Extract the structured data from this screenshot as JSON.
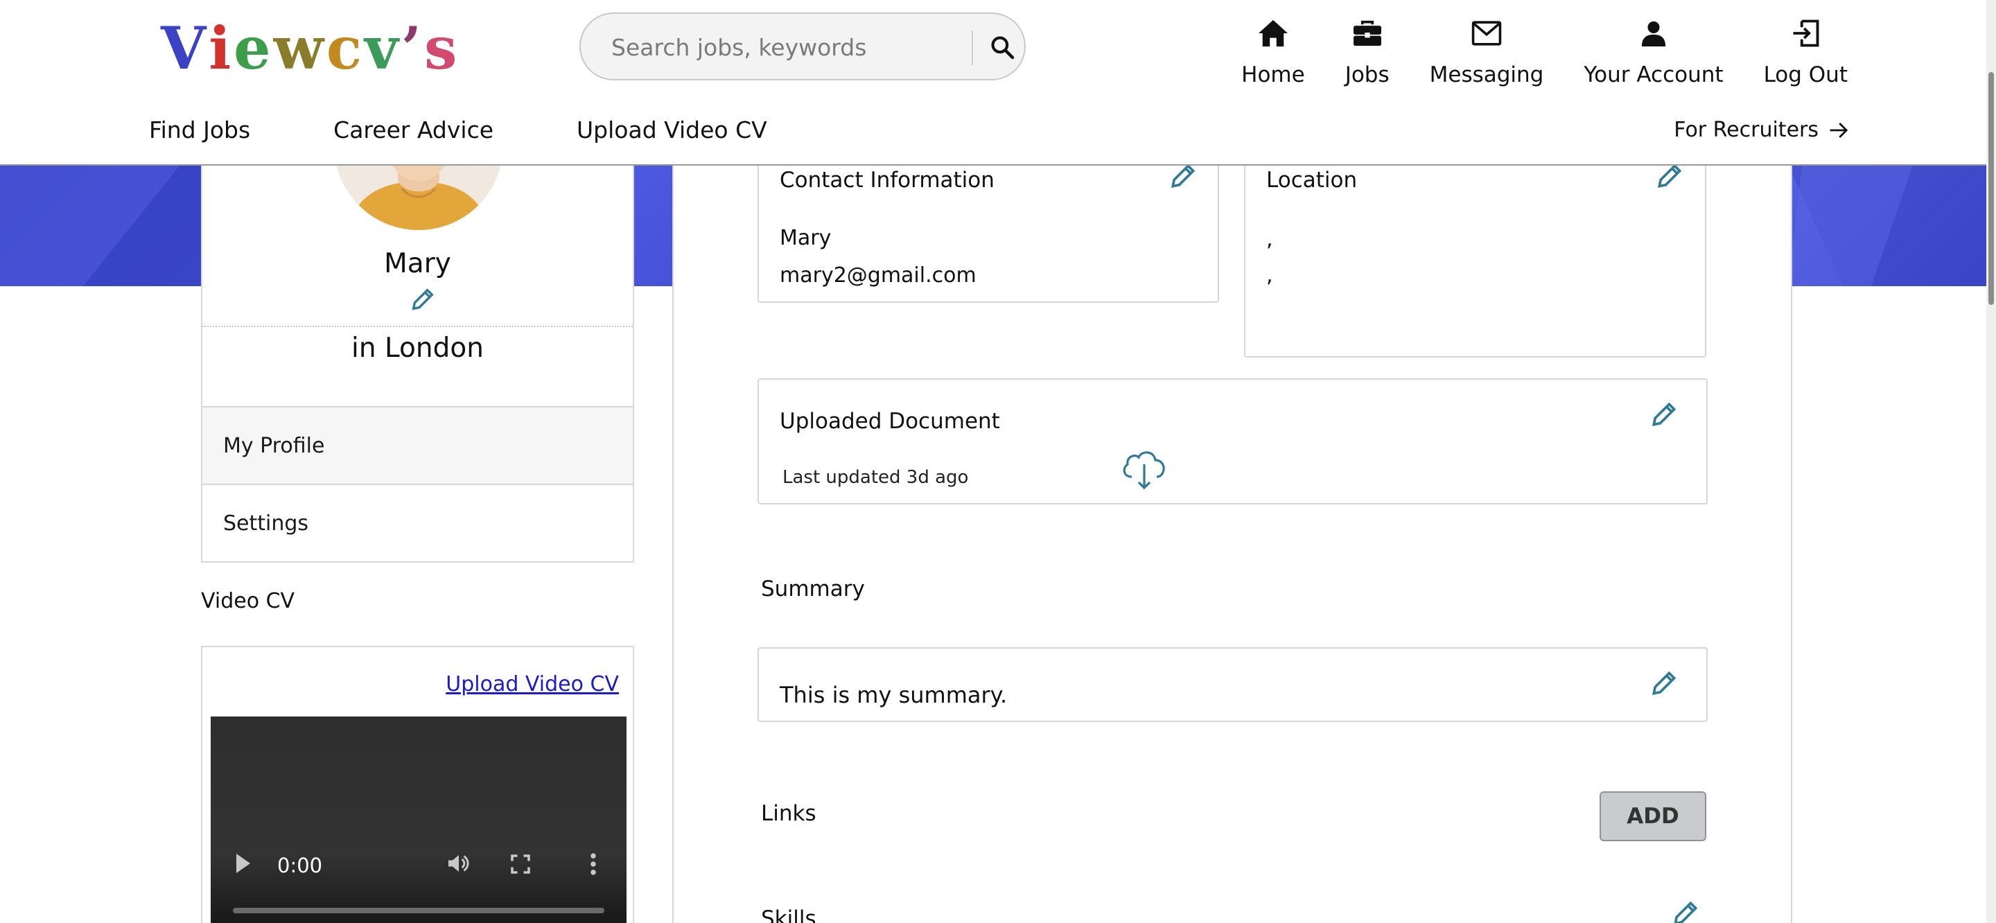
{
  "brand": {
    "logo_text": "Viewcv’s",
    "letters": [
      "V",
      "i",
      "e",
      "w",
      "c",
      "v",
      "’",
      "s"
    ],
    "letter_colors": [
      "#3b43c4",
      "#d2322d",
      "#3c9e4a",
      "#8a7d2a",
      "#c28a1e",
      "#3b9c5a",
      "#8c3a6a",
      "#d24a70"
    ]
  },
  "search": {
    "placeholder": "Search jobs, keywords",
    "button_icon": "search-icon"
  },
  "top_nav": [
    {
      "label": "Home",
      "icon": "home-icon"
    },
    {
      "label": "Jobs",
      "icon": "briefcase-icon"
    },
    {
      "label": "Messaging",
      "icon": "envelope-icon"
    },
    {
      "label": "Your Account",
      "icon": "user-icon"
    },
    {
      "label": "Log Out",
      "icon": "logout-icon"
    }
  ],
  "sub_nav": [
    "Find Jobs",
    "Career Advice",
    "Upload Video CV"
  ],
  "recruiters": {
    "label": "For Recruiters",
    "icon": "arrow-right-icon"
  },
  "profile": {
    "name": "Mary",
    "location": "in London",
    "menu": [
      "My Profile",
      "Settings"
    ]
  },
  "video_cv": {
    "title": "Video CV",
    "upload_link": "Upload Video CV",
    "time": "0:00"
  },
  "contact": {
    "title": "Contact Information",
    "name": "Mary",
    "email": "mary2@gmail.com"
  },
  "location_card": {
    "title": "Location",
    "line1": ",",
    "line2": ","
  },
  "document": {
    "title": "Uploaded Document",
    "updated": "Last updated 3d ago",
    "icon": "cloud-download-icon"
  },
  "summary": {
    "title": "Summary",
    "text": "This is my summary."
  },
  "links": {
    "title": "Links",
    "add_label": "ADD"
  },
  "skills": {
    "title": "Skills"
  },
  "colors": {
    "edit_icon": "#2f7a96",
    "hero": "#4450d4",
    "link": "#1a1ad0"
  }
}
